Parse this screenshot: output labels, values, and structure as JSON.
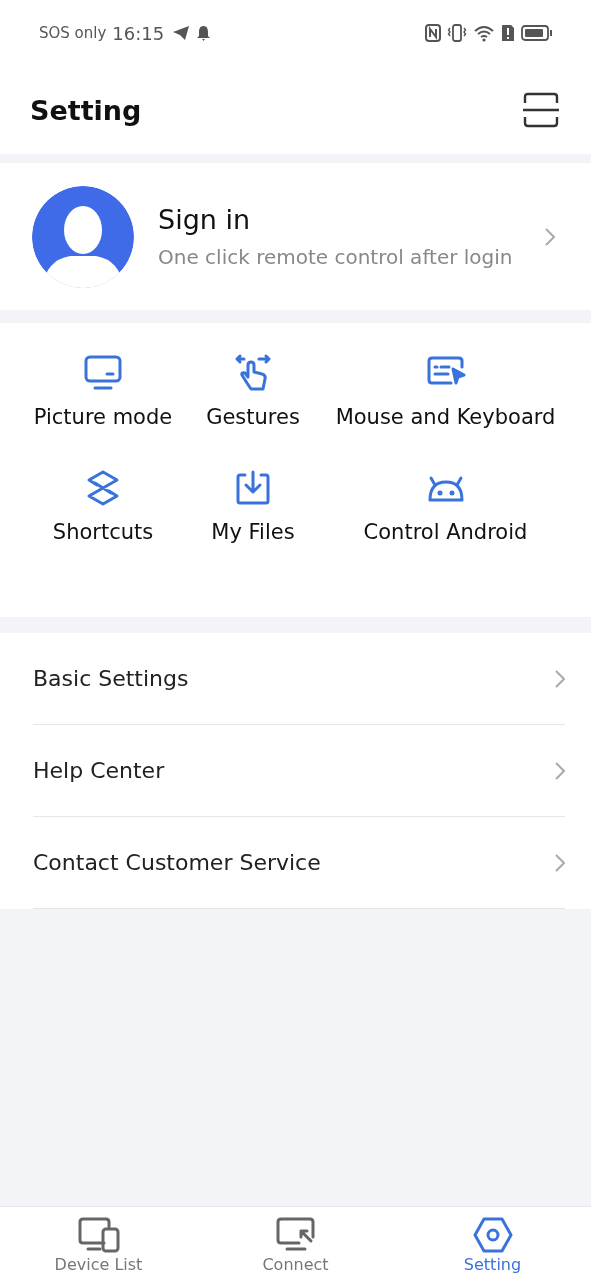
{
  "status_bar": {
    "carrier": "SOS only",
    "time": "16:15"
  },
  "header": {
    "title": "Setting"
  },
  "profile": {
    "title": "Sign in",
    "subtitle": "One click remote control after login"
  },
  "features": [
    {
      "label": "Picture mode",
      "kind": "monitor"
    },
    {
      "label": "Gestures",
      "kind": "gesture"
    },
    {
      "label": "Mouse and Keyboard",
      "kind": "keyboard"
    },
    {
      "label": "Shortcuts",
      "kind": "layers"
    },
    {
      "label": "My Files",
      "kind": "download"
    },
    {
      "label": "Control Android",
      "kind": "android"
    }
  ],
  "menu": [
    {
      "label": "Basic Settings"
    },
    {
      "label": "Help Center"
    },
    {
      "label": "Contact Customer Service"
    }
  ],
  "tabs": [
    {
      "label": "Device List",
      "kind": "devices",
      "selected": false
    },
    {
      "label": "Connect",
      "kind": "cast",
      "selected": false
    },
    {
      "label": "Setting",
      "kind": "settings",
      "selected": true
    }
  ]
}
